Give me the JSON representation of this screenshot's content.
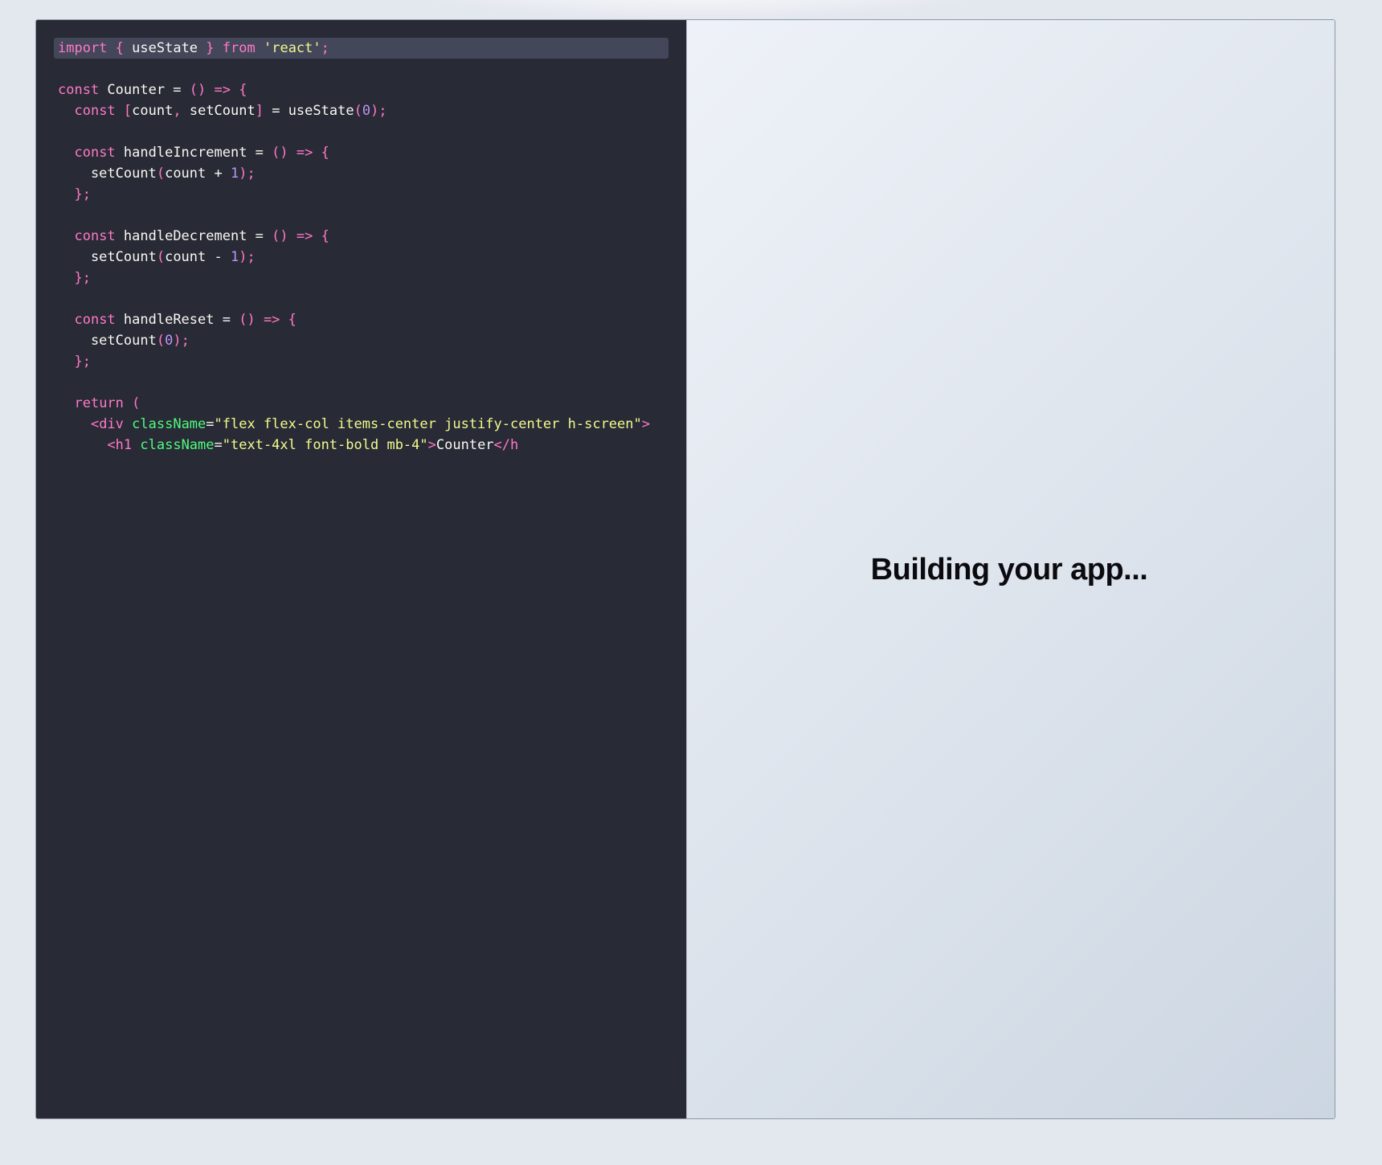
{
  "editor": {
    "lines": [
      [
        {
          "t": "import",
          "c": "kw"
        },
        {
          "t": " "
        },
        {
          "t": "{",
          "c": "pun"
        },
        {
          "t": " useState "
        },
        {
          "t": "}",
          "c": "pun"
        },
        {
          "t": " "
        },
        {
          "t": "from",
          "c": "kw"
        },
        {
          "t": " "
        },
        {
          "t": "'react'",
          "c": "str"
        },
        {
          "t": ";",
          "c": "pun"
        }
      ],
      [],
      [
        {
          "t": "const",
          "c": "kw"
        },
        {
          "t": " Counter = "
        },
        {
          "t": "()",
          "c": "pun"
        },
        {
          "t": " "
        },
        {
          "t": "=>",
          "c": "kw"
        },
        {
          "t": " "
        },
        {
          "t": "{",
          "c": "pun"
        }
      ],
      [
        {
          "t": "  "
        },
        {
          "t": "const",
          "c": "kw"
        },
        {
          "t": " "
        },
        {
          "t": "[",
          "c": "pun"
        },
        {
          "t": "count"
        },
        {
          "t": ",",
          "c": "pun"
        },
        {
          "t": " setCount"
        },
        {
          "t": "]",
          "c": "pun"
        },
        {
          "t": " = useState"
        },
        {
          "t": "(",
          "c": "pun"
        },
        {
          "t": "0",
          "c": "num"
        },
        {
          "t": ");",
          "c": "pun"
        }
      ],
      [],
      [
        {
          "t": "  "
        },
        {
          "t": "const",
          "c": "kw"
        },
        {
          "t": " handleIncrement = "
        },
        {
          "t": "()",
          "c": "pun"
        },
        {
          "t": " "
        },
        {
          "t": "=>",
          "c": "kw"
        },
        {
          "t": " "
        },
        {
          "t": "{",
          "c": "pun"
        }
      ],
      [
        {
          "t": "    setCount"
        },
        {
          "t": "(",
          "c": "pun"
        },
        {
          "t": "count + "
        },
        {
          "t": "1",
          "c": "num"
        },
        {
          "t": ");",
          "c": "pun"
        }
      ],
      [
        {
          "t": "  "
        },
        {
          "t": "};",
          "c": "pun"
        }
      ],
      [],
      [
        {
          "t": "  "
        },
        {
          "t": "const",
          "c": "kw"
        },
        {
          "t": " handleDecrement = "
        },
        {
          "t": "()",
          "c": "pun"
        },
        {
          "t": " "
        },
        {
          "t": "=>",
          "c": "kw"
        },
        {
          "t": " "
        },
        {
          "t": "{",
          "c": "pun"
        }
      ],
      [
        {
          "t": "    setCount"
        },
        {
          "t": "(",
          "c": "pun"
        },
        {
          "t": "count - "
        },
        {
          "t": "1",
          "c": "num"
        },
        {
          "t": ");",
          "c": "pun"
        }
      ],
      [
        {
          "t": "  "
        },
        {
          "t": "};",
          "c": "pun"
        }
      ],
      [],
      [
        {
          "t": "  "
        },
        {
          "t": "const",
          "c": "kw"
        },
        {
          "t": " handleReset = "
        },
        {
          "t": "()",
          "c": "pun"
        },
        {
          "t": " "
        },
        {
          "t": "=>",
          "c": "kw"
        },
        {
          "t": " "
        },
        {
          "t": "{",
          "c": "pun"
        }
      ],
      [
        {
          "t": "    setCount"
        },
        {
          "t": "(",
          "c": "pun"
        },
        {
          "t": "0",
          "c": "num"
        },
        {
          "t": ");",
          "c": "pun"
        }
      ],
      [
        {
          "t": "  "
        },
        {
          "t": "};",
          "c": "pun"
        }
      ],
      [],
      [
        {
          "t": "  "
        },
        {
          "t": "return",
          "c": "kw"
        },
        {
          "t": " "
        },
        {
          "t": "(",
          "c": "pun"
        }
      ],
      [
        {
          "t": "    "
        },
        {
          "t": "<div",
          "c": "kw"
        },
        {
          "t": " "
        },
        {
          "t": "className",
          "c": "attr"
        },
        {
          "t": "="
        },
        {
          "t": "\"flex flex-col items-center justify-center h-screen\"",
          "c": "str"
        },
        {
          "t": ">",
          "c": "kw"
        }
      ],
      [
        {
          "t": "      "
        },
        {
          "t": "<h1",
          "c": "kw"
        },
        {
          "t": " "
        },
        {
          "t": "className",
          "c": "attr"
        },
        {
          "t": "="
        },
        {
          "t": "\"text-4xl font-bold mb-4\"",
          "c": "str"
        },
        {
          "t": ">",
          "c": "kw"
        },
        {
          "t": "Counter"
        },
        {
          "t": "</h",
          "c": "kw"
        }
      ]
    ],
    "highlighted_line": 0,
    "colors": {
      "background": "#282a36",
      "keyword": "#ff79c6",
      "string": "#f1fa8c",
      "number": "#bd93f9",
      "attribute": "#50fa7b",
      "text": "#f8f8f2",
      "line_highlight": "#44475a"
    }
  },
  "preview": {
    "status_text": "Building your app..."
  }
}
